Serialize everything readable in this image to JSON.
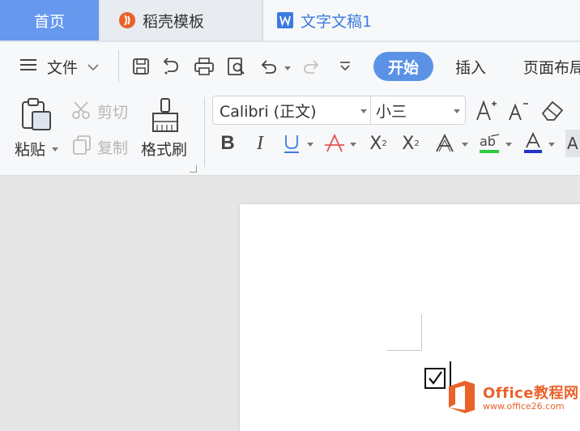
{
  "tabs": {
    "home": "首页",
    "template": "稻壳模板",
    "document": "文字文稿1"
  },
  "quick": {
    "menu_label": "文件",
    "active_tab": "开始",
    "insert_tab": "插入",
    "layout_tab": "页面布局"
  },
  "clipboard": {
    "paste": "粘贴",
    "cut": "剪切",
    "copy": "复制",
    "format_painter": "格式刷"
  },
  "font": {
    "name": "Calibri (正文)",
    "size": "小三",
    "superscript_mark": "2",
    "subscript_mark": "2"
  },
  "document": {
    "checkbox_mark": "☑"
  },
  "watermark": {
    "brand": "Office教程网",
    "url": "www.office26.com"
  },
  "colors": {
    "accent": "#5b92e5",
    "home_tab": "#6699ee",
    "watermark": "#e8622a",
    "highlight_bar": "#2ecc40",
    "font_color_bar": "#2233cc"
  }
}
